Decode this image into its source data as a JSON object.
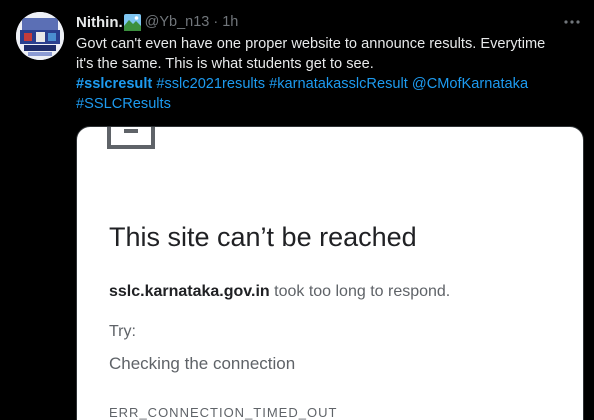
{
  "tweet": {
    "author_name": "Nithin.",
    "author_handle": "@Yb_n13",
    "separator": "·",
    "timestamp": "1h",
    "text_line1": "Govt can't even have one proper website to announce results. Everytime",
    "text_line2": "it's the same. This is what students get to see.",
    "hashtag_1": "#sslcresult",
    "hashtag_2": "#sslc2021results",
    "hashtag_3": "#karnatakasslcResult",
    "mention_1": "@CMofKarnataka",
    "hashtag_4": "#SSLCResults",
    "link_color": "#1d9bf0",
    "text_color": "#e7e9ea",
    "muted_color": "#71767b",
    "icons": {
      "name_emoji": "emoji-landscape-icon",
      "more": "more-options-icon"
    }
  },
  "media": {
    "error_title": "This site can’t be reached",
    "host": "sslc.karnataka.gov.in",
    "error_desc": "took too long to respond.",
    "try_label": "Try:",
    "suggestion_1": "Checking the connection",
    "error_code": "ERR_CONNECTION_TIMED_OUT",
    "icon": "broken-page-icon"
  }
}
